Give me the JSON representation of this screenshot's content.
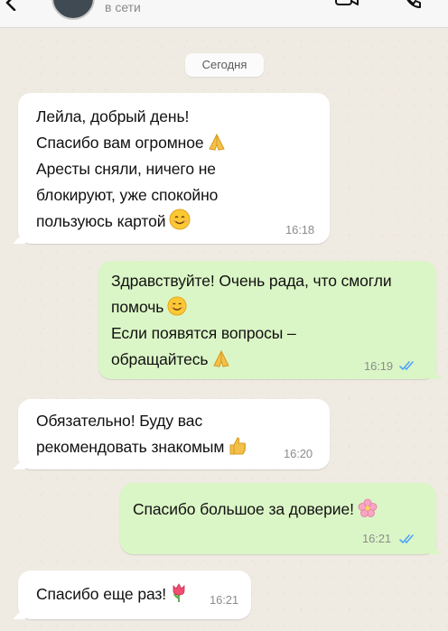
{
  "header": {
    "status": "в сети"
  },
  "date_separator": "Сегодня",
  "messages": [
    {
      "direction": "in",
      "lines": [
        "Лейла, добрый день!",
        "Спасибо вам огромное",
        "Аресты сняли, ничего не",
        "блокируют, уже спокойно",
        "пользуюсь картой"
      ],
      "time": "16:18"
    },
    {
      "direction": "out",
      "lines": [
        "Здравствуйте! Очень рада, что смогли",
        "помочь",
        "Если появятся вопросы –",
        "обращайтесь"
      ],
      "time": "16:19",
      "read": true
    },
    {
      "direction": "in",
      "lines": [
        "Обязательно! Буду вас",
        "рекомендовать знакомым"
      ],
      "time": "16:20"
    },
    {
      "direction": "out",
      "lines": [
        "Спасибо большое за доверие!"
      ],
      "time": "16:21",
      "read": true
    },
    {
      "direction": "in",
      "lines": [
        "Спасибо еще раз!"
      ],
      "time": "16:21"
    }
  ],
  "icons": {
    "back": "chevron-left-icon",
    "video": "video-call-icon",
    "call": "phone-icon",
    "read_receipt": "double-check-icon",
    "pray": "folded-hands-emoji",
    "smile": "smiling-face-emoji",
    "thumbs_up": "thumbs-up-emoji",
    "blossom": "cherry-blossom-emoji",
    "tulip": "tulip-emoji"
  },
  "colors": {
    "incoming_bubble": "#ffffff",
    "outgoing_bubble": "#dbf6c6",
    "background": "#efeae2",
    "read_receipt": "#4fa3f7"
  }
}
